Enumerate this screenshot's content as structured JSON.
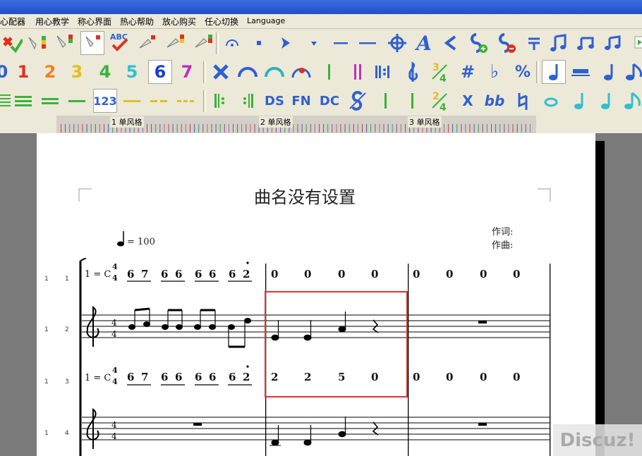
{
  "menu": {
    "items": [
      "心配器",
      "用心教学",
      "称心界面",
      "热心帮助",
      "放心购买",
      "任心切换",
      "Language"
    ]
  },
  "toolbar1": {
    "texts": {
      "abc": "ABC",
      "letter_a": "A"
    }
  },
  "toolbar2": {
    "digits": [
      "0",
      "1",
      "2",
      "3",
      "4",
      "5",
      "6",
      "7"
    ],
    "percent": "%",
    "sharp": "#",
    "flat": "♭"
  },
  "toolbar3": {
    "t123": "123",
    "ds": "DS",
    "fn": "FN",
    "dc": "DC",
    "x": "X",
    "bb": "bb"
  },
  "ruler": {
    "labels": [
      "1  单风格",
      "2  单风格",
      "3  单风格"
    ]
  },
  "score": {
    "title": "曲名没有设置",
    "tempo_value": "= 100",
    "lyricist_label": "作词:",
    "composer_label": "作曲:",
    "key_label": "1 = C",
    "time_top": "4",
    "time_bottom": "4",
    "row_numbers": [
      [
        "1",
        "1"
      ],
      [
        "1",
        "2"
      ],
      [
        "1",
        "3"
      ],
      [
        "1",
        "4"
      ]
    ],
    "jianpu_row1_m1": [
      "6",
      "7",
      "6",
      "6",
      "6",
      "6",
      "6",
      "2"
    ],
    "jianpu_row1_m2": [
      "0",
      "0",
      "0",
      "0"
    ],
    "jianpu_row1_m3": [
      "0",
      "0",
      "0",
      "0"
    ],
    "jianpu_row3_m1": [
      "6",
      "7",
      "6",
      "6",
      "6",
      "6",
      "6",
      "2"
    ],
    "jianpu_row3_m2": [
      "2",
      "2",
      "5",
      "0"
    ],
    "jianpu_row3_m3": [
      "0",
      "0",
      "0",
      "0"
    ]
  },
  "watermark": "Discuz!",
  "colors": {
    "highlight": "#e53030",
    "titlebar": "#1f4fc6",
    "chrome": "#ece9d8"
  }
}
